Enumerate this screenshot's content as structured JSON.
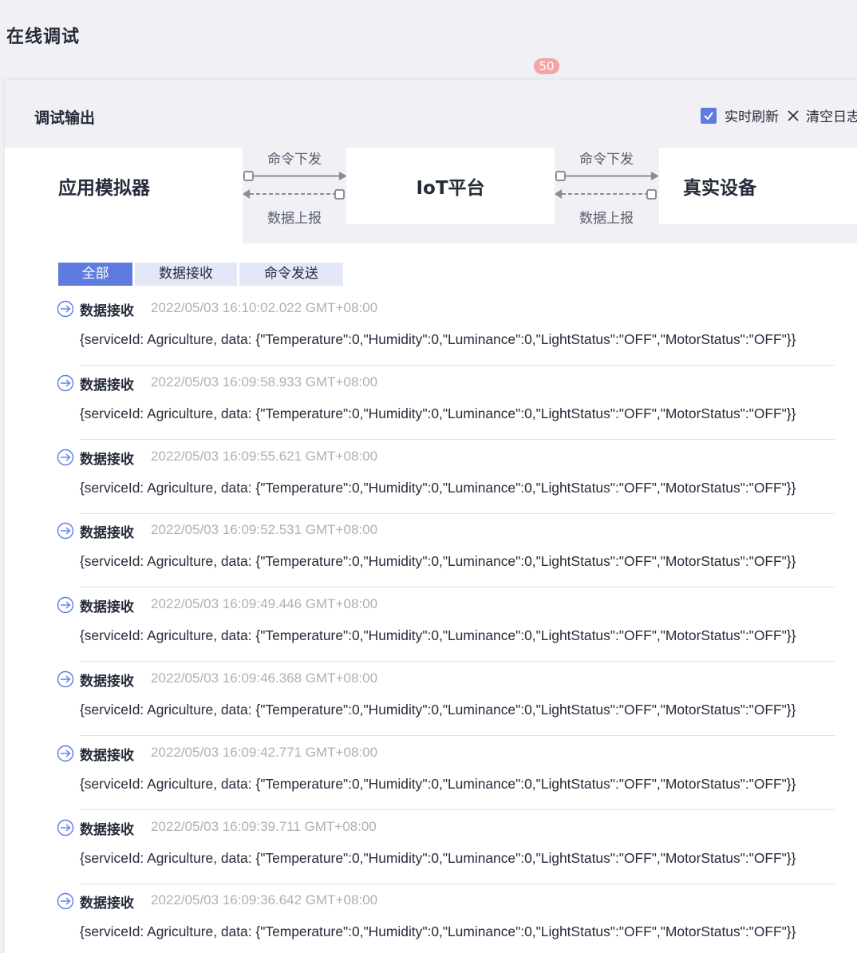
{
  "page": {
    "title": "在线调试"
  },
  "debug": {
    "title": "调试输出",
    "realtime_label": "实时刷新",
    "clear_label": "清空日志"
  },
  "flow": {
    "app_label": "应用模拟器",
    "iot_label": "IoT平台",
    "device_label": "真实设备",
    "cmd_down": "命令下发",
    "data_up": "数据上报",
    "badge_count": "50"
  },
  "tabs": [
    {
      "label": "全部",
      "active": true
    },
    {
      "label": "数据接收",
      "active": false
    },
    {
      "label": "命令发送",
      "active": false
    }
  ],
  "logs": [
    {
      "type": "数据接收",
      "time": "2022/05/03 16:10:02.022 GMT+08:00",
      "payload": "{serviceId: Agriculture, data: {\"Temperature\":0,\"Humidity\":0,\"Luminance\":0,\"LightStatus\":\"OFF\",\"MotorStatus\":\"OFF\"}}"
    },
    {
      "type": "数据接收",
      "time": "2022/05/03 16:09:58.933 GMT+08:00",
      "payload": "{serviceId: Agriculture, data: {\"Temperature\":0,\"Humidity\":0,\"Luminance\":0,\"LightStatus\":\"OFF\",\"MotorStatus\":\"OFF\"}}"
    },
    {
      "type": "数据接收",
      "time": "2022/05/03 16:09:55.621 GMT+08:00",
      "payload": "{serviceId: Agriculture, data: {\"Temperature\":0,\"Humidity\":0,\"Luminance\":0,\"LightStatus\":\"OFF\",\"MotorStatus\":\"OFF\"}}"
    },
    {
      "type": "数据接收",
      "time": "2022/05/03 16:09:52.531 GMT+08:00",
      "payload": "{serviceId: Agriculture, data: {\"Temperature\":0,\"Humidity\":0,\"Luminance\":0,\"LightStatus\":\"OFF\",\"MotorStatus\":\"OFF\"}}"
    },
    {
      "type": "数据接收",
      "time": "2022/05/03 16:09:49.446 GMT+08:00",
      "payload": "{serviceId: Agriculture, data: {\"Temperature\":0,\"Humidity\":0,\"Luminance\":0,\"LightStatus\":\"OFF\",\"MotorStatus\":\"OFF\"}}"
    },
    {
      "type": "数据接收",
      "time": "2022/05/03 16:09:46.368 GMT+08:00",
      "payload": "{serviceId: Agriculture, data: {\"Temperature\":0,\"Humidity\":0,\"Luminance\":0,\"LightStatus\":\"OFF\",\"MotorStatus\":\"OFF\"}}"
    },
    {
      "type": "数据接收",
      "time": "2022/05/03 16:09:42.771 GMT+08:00",
      "payload": "{serviceId: Agriculture, data: {\"Temperature\":0,\"Humidity\":0,\"Luminance\":0,\"LightStatus\":\"OFF\",\"MotorStatus\":\"OFF\"}}"
    },
    {
      "type": "数据接收",
      "time": "2022/05/03 16:09:39.711 GMT+08:00",
      "payload": "{serviceId: Agriculture, data: {\"Temperature\":0,\"Humidity\":0,\"Luminance\":0,\"LightStatus\":\"OFF\",\"MotorStatus\":\"OFF\"}}"
    },
    {
      "type": "数据接收",
      "time": "2022/05/03 16:09:36.642 GMT+08:00",
      "payload": "{serviceId: Agriculture, data: {\"Temperature\":0,\"Humidity\":0,\"Luminance\":0,\"LightStatus\":\"OFF\",\"MotorStatus\":\"OFF\"}}"
    }
  ]
}
